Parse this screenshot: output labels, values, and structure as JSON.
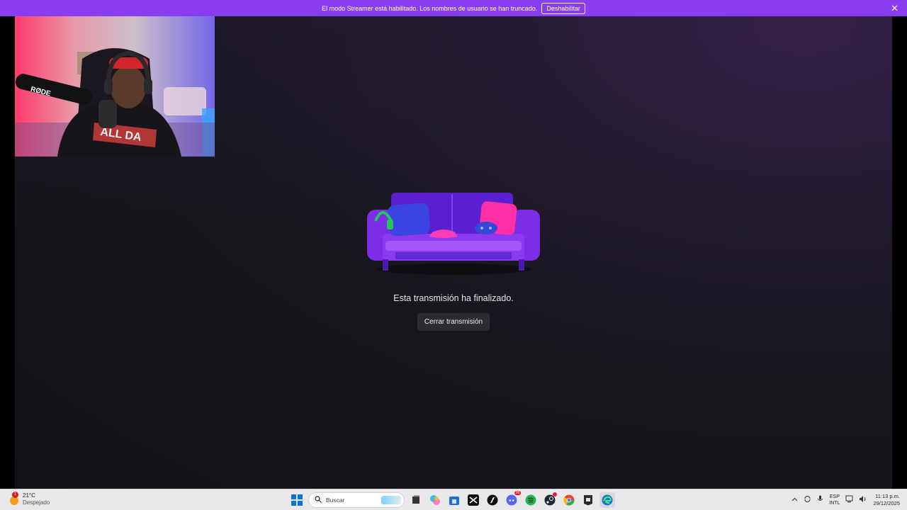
{
  "banner": {
    "message": "El modo Streamer está habilitado. Los nombres de usuario se han truncado.",
    "disable_label": "Deshabilitar",
    "close_glyph": "✕"
  },
  "stream": {
    "webcam_mic_brand": "RØDE",
    "webcam_shirt_text": "ALL DA",
    "ended_message": "Esta transmisión ha finalizado.",
    "close_stream_label": "Cerrar transmisión"
  },
  "taskbar": {
    "weather_temp": "21°C",
    "weather_desc": "Despejado",
    "weather_alert": "1",
    "search_placeholder": "Buscar",
    "discord_badge": "26",
    "lang_top": "ESP",
    "lang_bottom": "INTL",
    "time": "11:13 p.m.",
    "date": "29/12/2025"
  },
  "colors": {
    "banner": "#8a3df0",
    "stage_bg": "#131317",
    "button_bg": "#2c2c30",
    "taskbar_bg": "#e9e9ec"
  }
}
